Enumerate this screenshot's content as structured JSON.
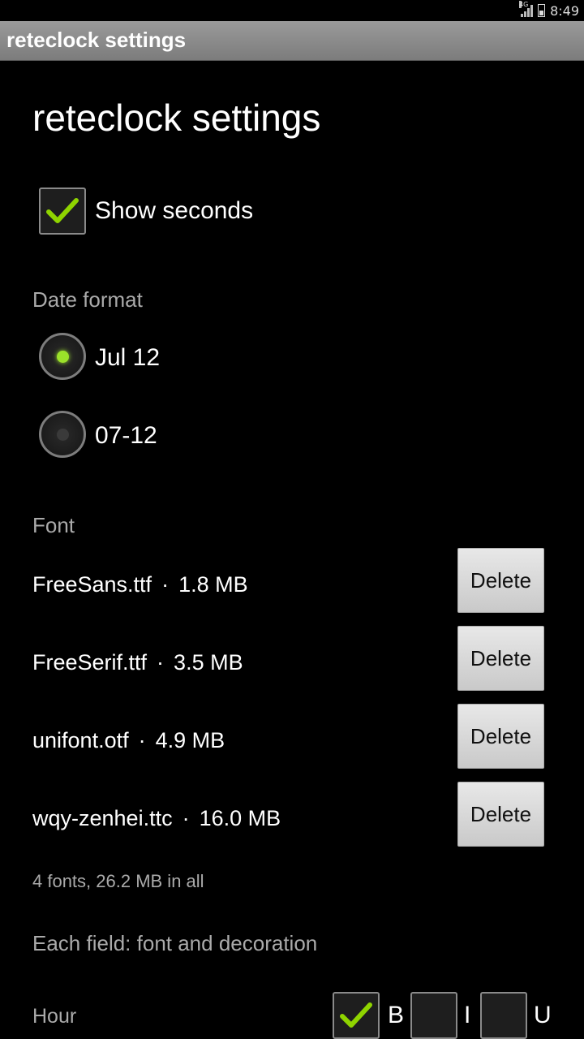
{
  "status_bar": {
    "network": "4G",
    "time": "8:49"
  },
  "app": {
    "title": "reteclock settings"
  },
  "page": {
    "heading": "reteclock settings"
  },
  "show_seconds": {
    "label": "Show seconds",
    "checked": true
  },
  "date_format": {
    "heading": "Date format",
    "options": [
      {
        "label": "Jul 12",
        "selected": true
      },
      {
        "label": "07-12",
        "selected": false
      }
    ]
  },
  "font": {
    "heading": "Font",
    "items": [
      {
        "name": "FreeSans.ttf",
        "size": "1.8 MB",
        "button": "Delete"
      },
      {
        "name": "FreeSerif.ttf",
        "size": "3.5 MB",
        "button": "Delete"
      },
      {
        "name": "unifont.otf",
        "size": "4.9 MB",
        "button": "Delete"
      },
      {
        "name": "wqy-zenhei.ttc",
        "size": "16.0 MB",
        "button": "Delete"
      }
    ],
    "separator": "·",
    "summary": "4 fonts, 26.2 MB in all"
  },
  "fields": {
    "heading": "Each field: font and decoration",
    "rows": [
      {
        "label": "Hour",
        "bold_label": "B",
        "bold_checked": true,
        "italic_label": "I",
        "italic_checked": false,
        "underline_label": "U",
        "underline_checked": false
      }
    ]
  },
  "colors": {
    "accent_check": "#8fd400",
    "radio_selected": "#9be12a",
    "radio_unselected": "#3a3a3a"
  }
}
